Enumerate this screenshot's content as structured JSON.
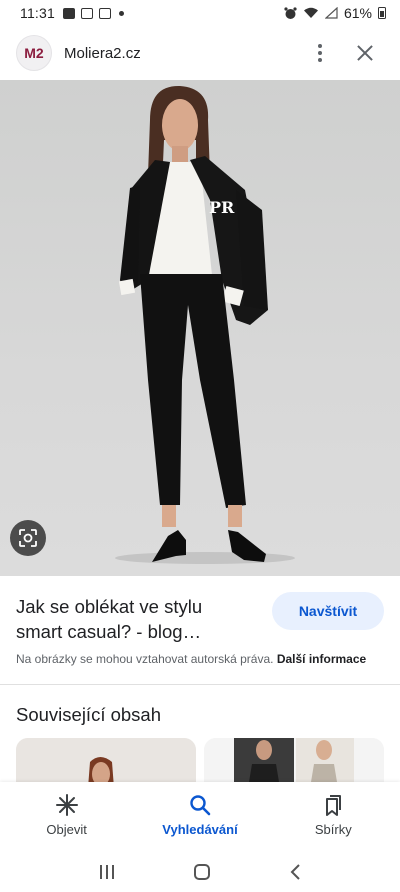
{
  "status_bar": {
    "time": "11:31",
    "battery_percent": "61%"
  },
  "header": {
    "site_logo_text": "M2",
    "site_name": "Moliera2.cz"
  },
  "result": {
    "title_line1": "Jak se oblékat ve stylu",
    "title_line2": "smart casual? - blog…",
    "visit_label": "Navštívit",
    "copyright_text": "Na obrázky se mohou vztahovat autorská práva. ",
    "more_info": "Další informace"
  },
  "related": {
    "title": "Související obsah"
  },
  "bottom_nav": {
    "items": [
      {
        "label": "Objevit",
        "icon": "asterisk-icon",
        "active": false
      },
      {
        "label": "Vyhledávání",
        "icon": "search-icon",
        "active": true
      },
      {
        "label": "Sbírky",
        "icon": "bookmarks-icon",
        "active": false
      }
    ]
  },
  "colors": {
    "accent": "#0b57d0",
    "visit_button_bg": "#e8f0fe",
    "logo_text": "#8b1d3f"
  },
  "icons": [
    "gallery-icon",
    "alarm-icon",
    "wifi-icon",
    "signal-icon",
    "battery-icon",
    "more-vert-icon",
    "close-icon",
    "lens-icon",
    "menu-lines-icon",
    "home-icon",
    "back-icon"
  ]
}
